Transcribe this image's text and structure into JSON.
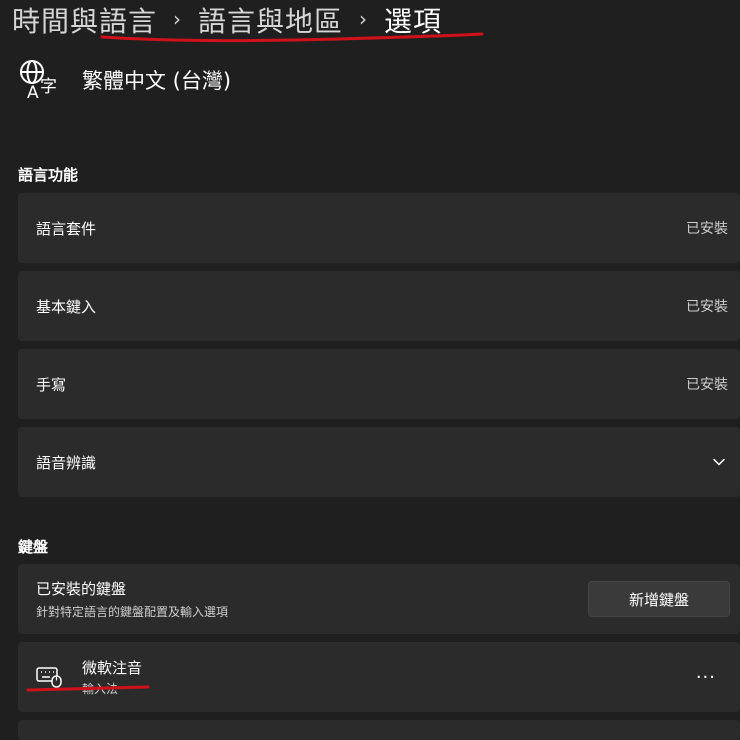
{
  "breadcrumb": {
    "item1": "時間與語言",
    "item2": "語言與地區",
    "current": "選項",
    "separator": "›"
  },
  "language": {
    "title": "繁體中文 (台灣)",
    "icon": "language-icon"
  },
  "language_features": {
    "heading": "語言功能",
    "items": [
      {
        "label": "語言套件",
        "status": "已安裝"
      },
      {
        "label": "基本鍵入",
        "status": "已安裝"
      },
      {
        "label": "手寫",
        "status": "已安裝"
      },
      {
        "label": "語音辨識",
        "status": ""
      }
    ]
  },
  "keyboard": {
    "heading": "鍵盤",
    "installed_title": "已安裝的鍵盤",
    "installed_sub": "針對特定語言的鍵盤配置及輸入選項",
    "add_button": "新增鍵盤",
    "items": [
      {
        "name": "微軟注音",
        "type": "輸入法",
        "more": "···"
      }
    ]
  },
  "colors": {
    "annotation": "#d0101a",
    "card": "#2b2b2b",
    "background": "#1f1f1f"
  }
}
